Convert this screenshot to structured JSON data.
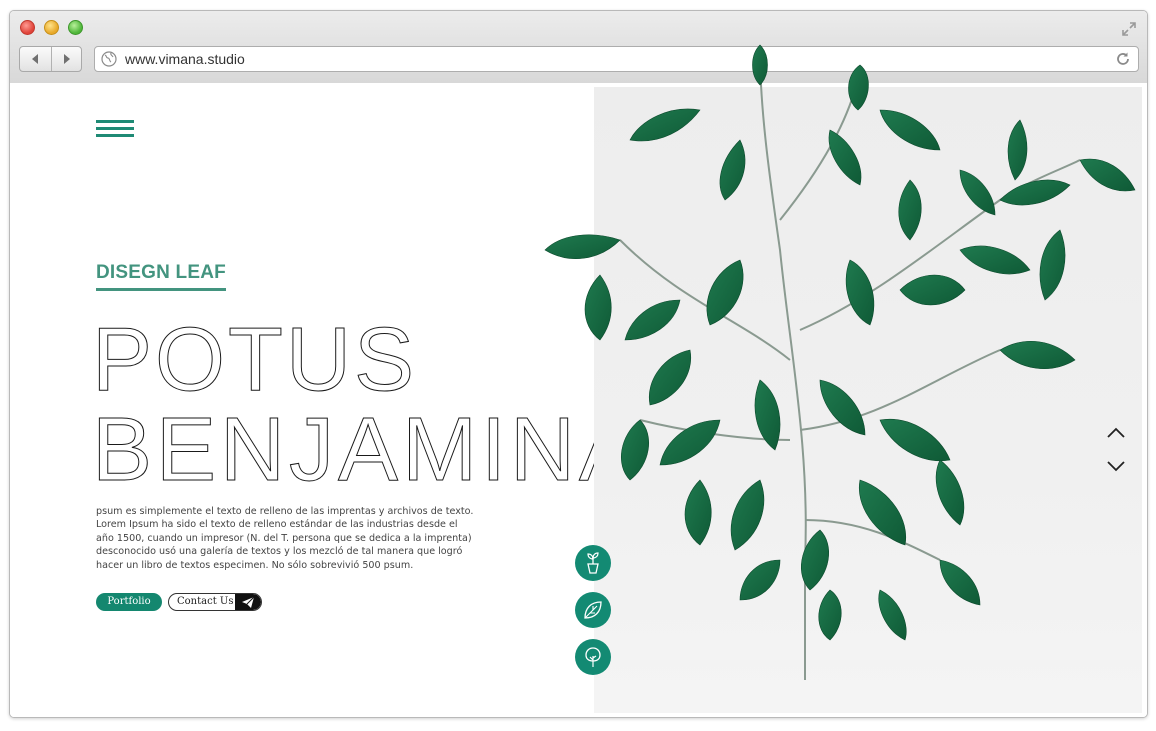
{
  "browser": {
    "url": "www.vimana.studio",
    "back_icon": "back-arrow-icon",
    "forward_icon": "forward-arrow-icon",
    "reload_icon": "reload-icon",
    "globe_icon": "globe-icon"
  },
  "hero": {
    "eyebrow": "DISEGN LEAF",
    "title_line1": "POTUS",
    "title_line2": "BENJAMINA",
    "description": "psum es simplemente el texto de relleno de las imprentas y archivos de texto. Lorem Ipsum ha sido el texto de relleno estándar de las industrias desde el año 1500, cuando un impresor (N. del T. persona que se dedica a la imprenta) desconocido usó una galería de textos y los mezcló de tal manera que logró hacer un libro de textos especimen. No sólo sobrevivió 500 psum.",
    "portfolio_label": "Portfolio",
    "contact_label": "Contact Us"
  },
  "nav": {
    "menu_icon": "hamburger-menu-icon",
    "up_icon": "chevron-up-icon",
    "down_icon": "chevron-down-icon"
  },
  "categories": [
    {
      "icon": "potted-plant-icon"
    },
    {
      "icon": "leaf-icon"
    },
    {
      "icon": "tree-icon"
    }
  ],
  "colors": {
    "accent": "#138a73",
    "eyebrow": "#43947f",
    "title_outline": "#1a1a1a"
  }
}
